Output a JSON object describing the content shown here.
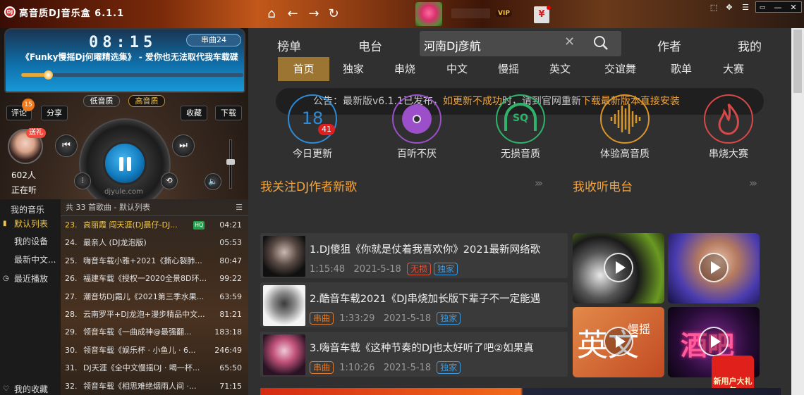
{
  "window": {
    "title": "高音质DJ音乐盒 6.1.1",
    "logo_text": "DJ",
    "vip_label": "VIP",
    "gift_label": "¥"
  },
  "player": {
    "time": "08:15",
    "play_mode": "串曲24",
    "now_playing": "《Funky慢摇Dj何曜精选集》 - 爱你也无法取代我车载碟",
    "progress": 0.12,
    "volume": 0.55,
    "quality_low": "低音质",
    "quality_high": "高音质",
    "comment_label": "评论",
    "comment_count": "15",
    "share_label": "分享",
    "favorite_label": "收藏",
    "download_label": "下载",
    "gift_tag": "送礼",
    "listeners": "602人",
    "listening_status": "正在听",
    "site_mark": "djyule.com"
  },
  "sidebar": {
    "items": [
      {
        "label": "我的音乐",
        "icon": "",
        "active": false
      },
      {
        "label": "默认列表",
        "icon": "bars-icon",
        "active": true
      },
      {
        "label": "我的设备",
        "icon": "",
        "active": false
      },
      {
        "label": "最新中文...",
        "icon": "",
        "active": false
      },
      {
        "label": "最近播放",
        "icon": "clock-icon",
        "active": false
      },
      {
        "label": "我的收藏",
        "icon": "heart-icon",
        "active": false
      }
    ]
  },
  "songlist": {
    "header": "共 33 首歌曲 - 默认列表",
    "rows": [
      {
        "no": "23.",
        "title": "高丽霞 闯天涯(DJ晨仔-DJ...",
        "hq": "HQ",
        "time": "04:21",
        "current": true
      },
      {
        "no": "24.",
        "title": "最亲人 (DJ龙泡版)",
        "hq": "",
        "time": "05:53",
        "current": false
      },
      {
        "no": "25.",
        "title": "嗨音车载小雅+2021《撕心裂肺...",
        "hq": "",
        "time": "80:47",
        "current": false
      },
      {
        "no": "26.",
        "title": "福建车载《授权一2020全景8D环...",
        "hq": "",
        "time": "99:22",
        "current": false
      },
      {
        "no": "27.",
        "title": "潮音坊DJ霜儿《2021第三季水果...",
        "hq": "",
        "time": "63:59",
        "current": false
      },
      {
        "no": "28.",
        "title": "云南罗平+DJ龙泡+漫步精品中文...",
        "hq": "",
        "time": "81:21",
        "current": false
      },
      {
        "no": "29.",
        "title": "领音车载《一曲成神@最强翻...",
        "hq": "",
        "time": "183:18",
        "current": false
      },
      {
        "no": "30.",
        "title": "领音车载《娱乐杯 · 小鱼儿 · 6...",
        "hq": "",
        "time": "246:49",
        "current": false
      },
      {
        "no": "31.",
        "title": "DJ天涯《全中文慢摇DJ · 喝一杯...",
        "hq": "",
        "time": "65:50",
        "current": false
      },
      {
        "no": "32.",
        "title": "领音车载《相思难绝烟雨人间 ·...",
        "hq": "",
        "time": "71:15",
        "current": false
      }
    ]
  },
  "main": {
    "top_nav": [
      {
        "label": "榜单"
      },
      {
        "label": "电台"
      },
      {
        "label": "作者"
      },
      {
        "label": "我的"
      }
    ],
    "search": {
      "value": "河南Dj彦航"
    },
    "sub_tabs": [
      {
        "label": "首页",
        "active": true
      },
      {
        "label": "独家",
        "active": false
      },
      {
        "label": "串烧",
        "active": false
      },
      {
        "label": "中文",
        "active": false
      },
      {
        "label": "慢摇",
        "active": false
      },
      {
        "label": "英文",
        "active": false
      },
      {
        "label": "交谊舞",
        "active": false
      },
      {
        "label": "歌单",
        "active": false
      },
      {
        "label": "大赛",
        "active": false
      }
    ],
    "notice": {
      "prefix": "公告：最新版v6.1.1已发布，",
      "warn1": "如更新不成功",
      "middle": "时，请到官网重新",
      "warn2": "下载最新版本直接安装"
    },
    "quick_links": [
      {
        "label": "今日更新",
        "value": "18",
        "badge": "41",
        "color": "#2c8bd8"
      },
      {
        "label": "百听不厌",
        "value": "",
        "badge": "",
        "color": "#9b4fc8"
      },
      {
        "label": "无损音质",
        "value": "SQ",
        "badge": "",
        "color": "#2fb36a"
      },
      {
        "label": "体验高音质",
        "value": "",
        "badge": "",
        "color": "#d8952a"
      },
      {
        "label": "串烧大赛",
        "value": "",
        "badge": "",
        "color": "#d84848"
      }
    ],
    "follow_section_title": "我关注DJ作者新歌",
    "station_section_title": "我收听电台",
    "more_glyph": "›››",
    "feed": [
      {
        "title": "1.DJ傻狙《你就是仗着我喜欢你》2021最新网络歌",
        "duration": "1:15:48",
        "date": "2021-5-18",
        "tags": [
          {
            "text": "无损",
            "kind": "lossless"
          },
          {
            "text": "独家",
            "kind": "exclusive"
          }
        ]
      },
      {
        "title": "2.酷音车载2021《DJ串烧加长版下辈子不一定能遇",
        "duration": "1:33:29",
        "date": "2021-5-18",
        "tags": [
          {
            "text": "串曲",
            "kind": "medley",
            "lead": true
          },
          {
            "text": "独家",
            "kind": "exclusive"
          }
        ]
      },
      {
        "title": "3.嗨音车载《这种节奏的DJ也太好听了吧②如果真",
        "duration": "1:10:26",
        "date": "2021-5-18",
        "tags": [
          {
            "text": "串曲",
            "kind": "medley",
            "lead": true
          },
          {
            "text": "独家",
            "kind": "exclusive"
          }
        ]
      }
    ],
    "stations": [
      {
        "text": ""
      },
      {
        "text": ""
      },
      {
        "text": "英文",
        "sub": "慢摇"
      },
      {
        "text": "酒吧"
      }
    ],
    "new_user_label": "新用户大礼包"
  },
  "colors": {
    "accent_gold": "#f3c844",
    "accent_orange": "#f3a33a",
    "tab_active_bg": "#9b7531"
  }
}
